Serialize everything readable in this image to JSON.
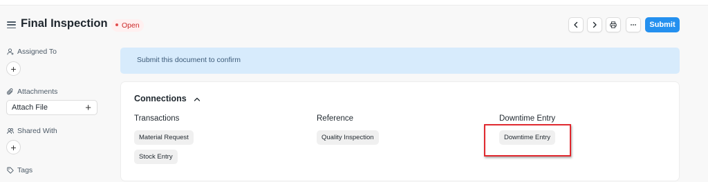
{
  "header": {
    "title": "Final Inspection",
    "status": "Open",
    "submit_label": "Submit",
    "icons": [
      "hamburger-icon",
      "chevron-left-icon",
      "chevron-right-icon",
      "printer-icon",
      "ellipsis-icon"
    ]
  },
  "sidebar": {
    "assigned_to": "Assigned To",
    "attachments": "Attachments",
    "attach_file": "Attach File",
    "shared_with": "Shared With",
    "tags": "Tags"
  },
  "alert": {
    "message": "Submit this document to confirm"
  },
  "connections": {
    "title": "Connections",
    "groups": [
      {
        "title": "Transactions",
        "items": [
          "Material Request",
          "Stock Entry"
        ]
      },
      {
        "title": "Reference",
        "items": [
          "Quality Inspection"
        ]
      },
      {
        "title": "Downtime Entry",
        "items": [
          "Downtime Entry"
        ]
      }
    ]
  },
  "colors": {
    "primary": "#2490ef",
    "status_red": "#cb2929",
    "alert_bg": "#d7ebfc",
    "highlight_red": "#e0282e"
  }
}
